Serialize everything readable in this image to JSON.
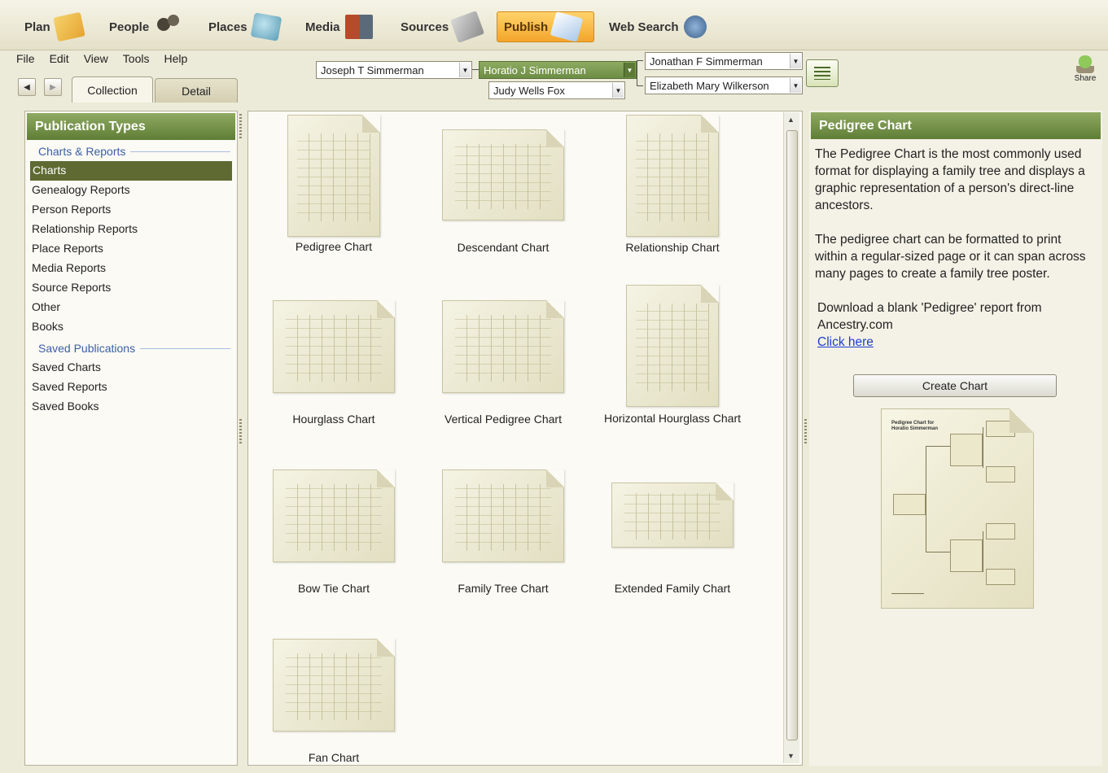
{
  "modules": [
    {
      "label": "Plan",
      "icon": "plan-icon"
    },
    {
      "label": "People",
      "icon": "people-icon"
    },
    {
      "label": "Places",
      "icon": "places-icon"
    },
    {
      "label": "Media",
      "icon": "media-icon"
    },
    {
      "label": "Sources",
      "icon": "sources-icon"
    },
    {
      "label": "Publish",
      "icon": "publish-icon",
      "active": true
    },
    {
      "label": "Web Search",
      "icon": "web-search-icon"
    }
  ],
  "menu": [
    "File",
    "Edit",
    "View",
    "Tools",
    "Help"
  ],
  "view_tabs": {
    "collection": "Collection",
    "detail": "Detail"
  },
  "family": {
    "person": "Joseph T Simmerman",
    "father": "Horatio J Simmerman",
    "mother": "Judy Wells Fox",
    "paternal_grandfather": "Jonathan F Simmerman",
    "paternal_grandmother": "Elizabeth Mary Wilkerson"
  },
  "share_label": "Share",
  "left_panel": {
    "title": "Publication Types",
    "section1": "Charts & Reports",
    "items1": [
      "Charts",
      "Genealogy Reports",
      "Person Reports",
      "Relationship Reports",
      "Place Reports",
      "Media Reports",
      "Source Reports",
      "Other",
      "Books"
    ],
    "selected": "Charts",
    "section2": "Saved Publications",
    "items2": [
      "Saved Charts",
      "Saved Reports",
      "Saved Books"
    ]
  },
  "charts": [
    "Pedigree Chart",
    "Descendant Chart",
    "Relationship Chart",
    "Hourglass Chart",
    "Vertical Pedigree Chart",
    "Horizontal Hourglass Chart",
    "Bow Tie Chart",
    "Family Tree Chart",
    "Extended Family Chart",
    "Fan Chart"
  ],
  "detail": {
    "title": "Pedigree Chart",
    "p1": "The Pedigree Chart is the most commonly used format for displaying a family tree and displays a graphic representation of a person's direct-line ancestors.",
    "p2": "The pedigree chart can be formatted to print within a regular-sized page or it can span across many pages to create a family tree poster.",
    "p3": "Download a blank 'Pedigree' report from Ancestry.com",
    "link": "Click here",
    "button": "Create Chart",
    "preview_title": "Pedigree Chart for Horatio Simmerman"
  },
  "colors": {
    "accent_green": "#6f8d44",
    "publish_orange": "#f3a52c",
    "link_blue": "#1d3ecf"
  }
}
